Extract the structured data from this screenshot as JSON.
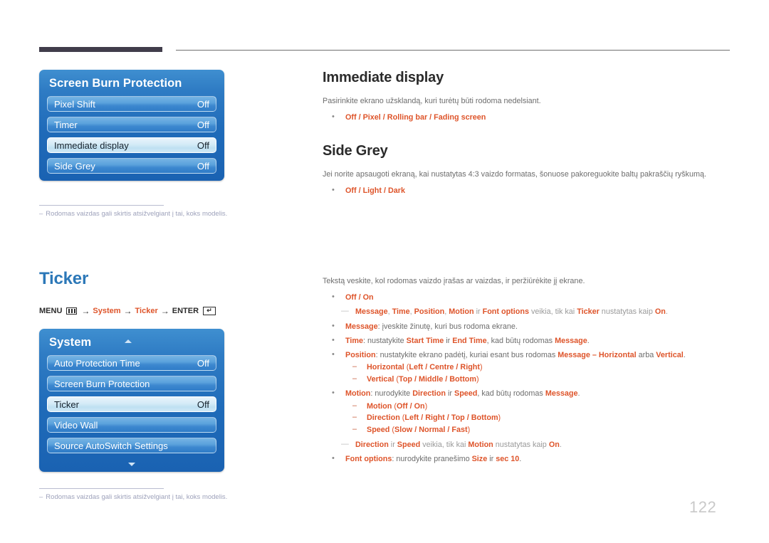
{
  "page": {
    "number": "122"
  },
  "header": {
    "bar": "",
    "rule": ""
  },
  "osd_panels": [
    {
      "title": "Screen Burn Protection",
      "title_arrow": null,
      "footer_arrow": null,
      "rows": [
        {
          "label": "Pixel Shift",
          "value": "Off",
          "selected": false
        },
        {
          "label": "Timer",
          "value": "Off",
          "selected": false
        },
        {
          "label": "Immediate display",
          "value": "Off",
          "selected": true
        },
        {
          "label": "Side Grey",
          "value": "Off",
          "selected": false
        }
      ]
    },
    {
      "title": "System",
      "title_arrow": "arrow-up-icon",
      "footer_arrow": "arrow-down-icon",
      "rows": [
        {
          "label": "Auto Protection Time",
          "value": "Off",
          "selected": false
        },
        {
          "label": "Screen Burn Protection",
          "value": "",
          "selected": false
        },
        {
          "label": "Ticker",
          "value": "Off",
          "selected": true
        },
        {
          "label": "Video Wall",
          "value": "",
          "selected": false
        },
        {
          "label": "Source AutoSwitch Settings",
          "value": "",
          "selected": false
        }
      ]
    }
  ],
  "notes": [
    {
      "dash": "–",
      "text": "Rodomas vaizdas gali skirtis atsižvelgiant į tai, koks modelis."
    },
    {
      "dash": "–",
      "text": "Rodomas vaizdas gali skirtis atsižvelgiant į tai, koks modelis."
    }
  ],
  "ticker": {
    "heading": "Ticker",
    "breadcrumb": {
      "menu_label": "MENU",
      "menu_icon": "menu-icon",
      "arrow1": "→",
      "item1": "System",
      "arrow2": "→",
      "item2": "Ticker",
      "arrow3": "→",
      "enter_label": "ENTER",
      "enter_icon": "enter-icon",
      "enter_glyph": "↵"
    }
  },
  "sections": {
    "immediate_display": {
      "heading": "Immediate display",
      "desc": "Pasirinkite ekrano užsklandą, kuri turėtų būti rodoma nedelsiant.",
      "options": "Off / Pixel / Rolling bar / Fading screen"
    },
    "side_grey": {
      "heading": "Side Grey",
      "desc": "Jei norite apsaugoti ekraną, kai nustatytas 4:3 vaizdo formatas, šonuose pakoreguokite baltų pakraščių ryškumą.",
      "options": "Off / Light / Dark"
    },
    "ticker_body": {
      "desc": "Tekstą veskite, kol rodomas vaizdo įrašas ar vaizdas, ir peržiūrėkite jį ekrane.",
      "opt_onoff": "Off / On",
      "note_ticker": {
        "b1": "Message",
        "s1": ", ",
        "b2": "Time",
        "s2": ", ",
        "b3": "Position",
        "s3": ", ",
        "b4": "Motion",
        "s4": " ir ",
        "b5": "Font options",
        "s5": " veikia, tik kai ",
        "b6": "Ticker",
        "s6": " nustatytas kaip ",
        "b7": "On",
        "s7": "."
      },
      "message": {
        "term": "Message",
        "rest": ": įveskite žinutę, kuri bus rodoma ekrane."
      },
      "time": {
        "term": "Time",
        "p1": ": nustatykite ",
        "b1": "Start Time",
        "p2": " ir ",
        "b2": "End Time",
        "p3": ", kad būtų rodomas ",
        "b3": "Message",
        "p4": "."
      },
      "position": {
        "term": "Position",
        "p1": ": nustatykite ekrano padėtį, kuriai esant bus rodomas ",
        "b1": "Message – Horizontal",
        "p2": " arba ",
        "b2": "Vertical",
        "p3": "."
      },
      "position_sub": [
        {
          "term": "Horizontal",
          "open": " (",
          "opts": "Left / Centre / Right",
          "close": ")"
        },
        {
          "term": "Vertical",
          "open": " (",
          "opts": "Top / Middle / Bottom",
          "close": ")"
        }
      ],
      "motion": {
        "term": "Motion",
        "p1": ": nurodykite ",
        "b1": "Direction",
        "p2": " ir ",
        "b2": "Speed",
        "p3": ", kad būtų rodomas ",
        "b3": "Message",
        "p4": "."
      },
      "motion_sub": [
        {
          "term": "Motion",
          "open": " (",
          "opts": "Off / On",
          "close": ")"
        },
        {
          "term": "Direction",
          "open": " (",
          "opts": "Left / Right / Top / Bottom",
          "close": ")"
        },
        {
          "term": "Speed",
          "open": " (",
          "opts": "Slow / Normal / Fast",
          "close": ")"
        }
      ],
      "note_motion": {
        "b1": "Direction",
        "s1": " ir ",
        "b2": "Speed",
        "s2": " veikia, tik kai ",
        "b3": "Motion",
        "s3": " nustatytas kaip ",
        "b4": "On",
        "s4": "."
      },
      "font_options": {
        "term": "Font options",
        "p1": ": nurodykite pranešimo ",
        "b1": "Size",
        "p2": " ir ",
        "b2": "sec 10",
        "p3": "."
      }
    }
  },
  "colors": {
    "accent_orange": "#de542a",
    "heading_blue": "#2c78b8",
    "osd_blue": "#1f6bb9",
    "note_grey": "#9ea2bb"
  }
}
